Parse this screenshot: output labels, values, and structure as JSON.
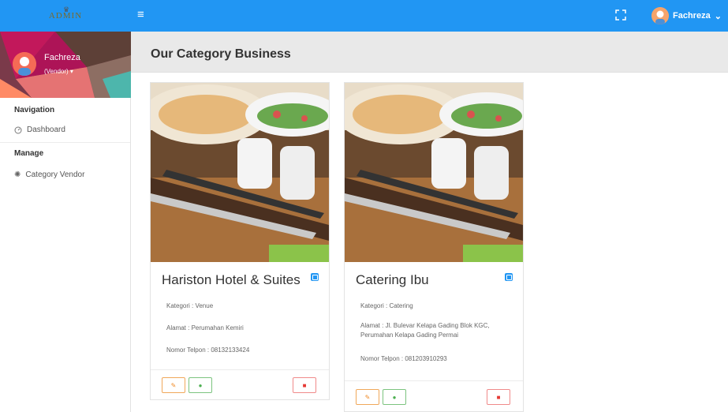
{
  "app": {
    "logo_text": "ADMIN"
  },
  "topbar": {
    "user_name": "Fachreza",
    "user_chevron": "⌄"
  },
  "sidebar": {
    "profile_name": "Fachreza",
    "profile_role": "(Vendor)",
    "sections": [
      {
        "heading": "Navigation",
        "items": [
          {
            "label": "Dashboard",
            "icon": "dashboard-icon"
          }
        ]
      },
      {
        "heading": "Manage",
        "items": [
          {
            "label": "Category Vendor",
            "icon": "gear-icon"
          }
        ]
      }
    ]
  },
  "page": {
    "title": "Our Category Business"
  },
  "cards": [
    {
      "title": "Hariston Hotel & Suites",
      "kategori": "Kategori : Venue",
      "alamat": "Alamat : Perumahan Kemiri",
      "telpon": "Nomor Telpon : 08132133424"
    },
    {
      "title": "Catering Ibu",
      "kategori": "Kategori : Catering",
      "alamat": "Alamat : Jl. Bulevar Kelapa Gading Blok KGC, Perumahan Kelapa Gading Permai",
      "telpon": "Nomor Telpon : 081203910293"
    }
  ],
  "colors": {
    "primary": "#2196f3",
    "edit": "#f08c2a",
    "view": "#4caf50",
    "delete": "#e53935"
  }
}
